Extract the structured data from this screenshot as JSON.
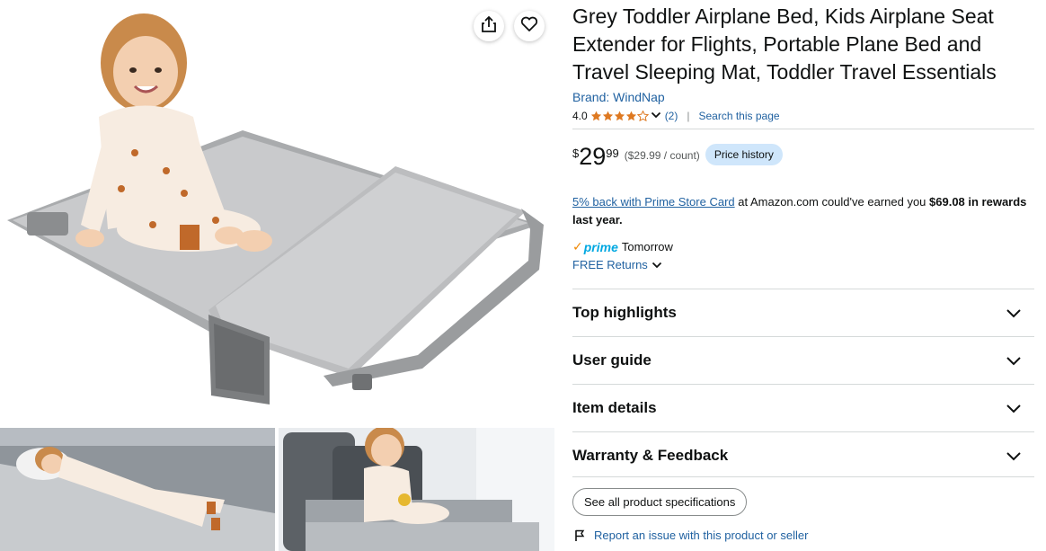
{
  "product": {
    "title": "Grey Toddler Airplane Bed, Kids Airplane Seat Extender for Flights, Portable Plane Bed and Travel Sleeping Mat, Toddler Travel Essentials",
    "brand": "Brand: WindNap"
  },
  "rating": {
    "value": "4.0",
    "stars": 4,
    "count": "(2)",
    "separator": "|",
    "search_link": "Search this page"
  },
  "price": {
    "symbol": "$",
    "whole": "29",
    "fraction": "99",
    "unit_price": "($29.99 / count)",
    "history_button": "Price history"
  },
  "cashback": {
    "link": "5% back with Prime Store Card",
    "text": " at Amazon.com could've earned you ",
    "amount": "$69.08 in rewards last year."
  },
  "delivery": {
    "prime_check": "✓",
    "prime_label": "prime",
    "day": "Tomorrow",
    "returns": "FREE Returns"
  },
  "accordion": [
    {
      "label": "Top highlights"
    },
    {
      "label": "User guide"
    },
    {
      "label": "Item details"
    },
    {
      "label": "Warranty & Feedback"
    }
  ],
  "spec_button": "See all product specifications",
  "report_link": "Report an issue with this product or seller",
  "icons": {
    "share": "share-icon",
    "heart": "heart-icon",
    "star": "star-icon",
    "chevron": "chevron-down-icon",
    "flag": "flag-icon"
  },
  "colors": {
    "link": "#2162a1",
    "star": "#de7921",
    "prime": "#00a8e1",
    "price_history_bg": "#cfe6fb"
  }
}
